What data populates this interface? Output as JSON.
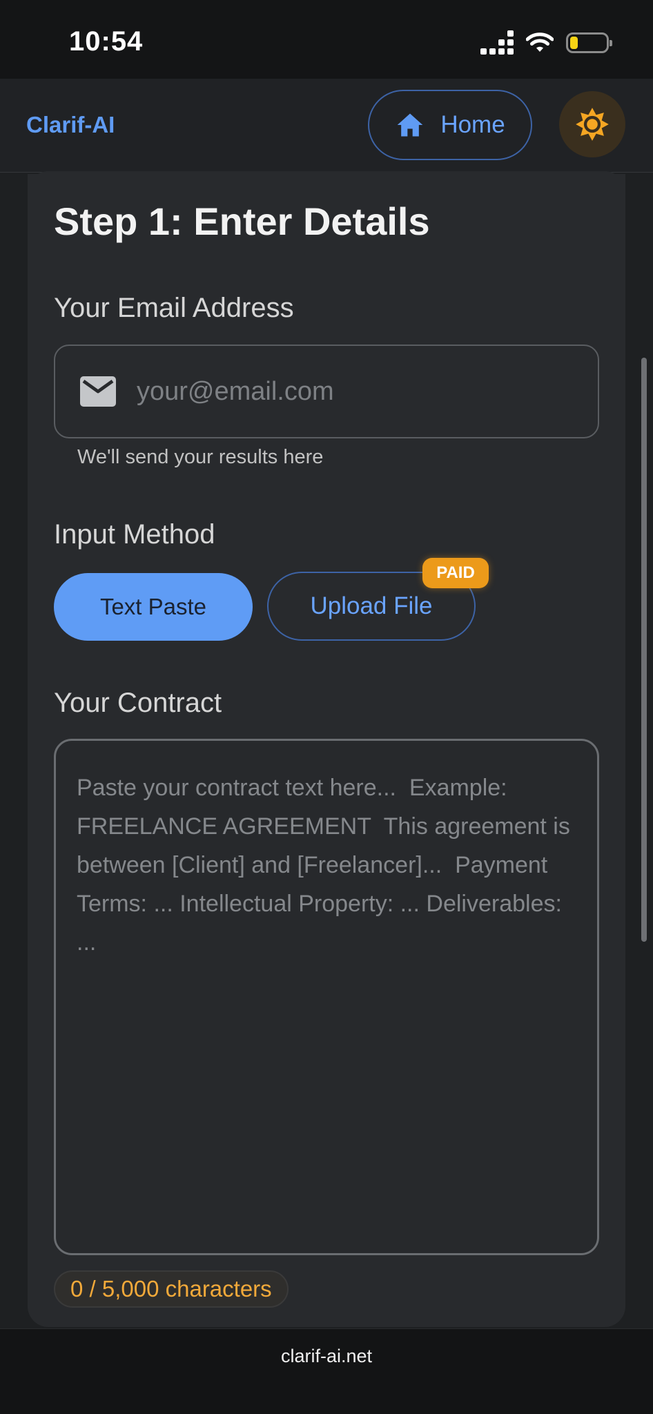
{
  "status_bar": {
    "time": "10:54"
  },
  "header": {
    "brand": "Clarif-AI",
    "home_label": "Home"
  },
  "form": {
    "step_title": "Step 1: Enter Details",
    "email_label": "Your Email Address",
    "email_placeholder": "your@email.com",
    "email_value": "",
    "email_helper": "We'll send your results here",
    "input_method_label": "Input Method",
    "text_paste_label": "Text Paste",
    "upload_file_label": "Upload File",
    "paid_badge": "PAID",
    "contract_label": "Your Contract",
    "contract_placeholder": "Paste your contract text here...  Example:  FREELANCE AGREEMENT  This agreement is between [Client] and [Freelancer]...  Payment Terms: ... Intellectual Property: ... Deliverables: ...",
    "char_count": "0 / 5,000 characters"
  },
  "footer": {
    "url": "clarif-ai.net"
  },
  "colors": {
    "accent": "#5f9cf5",
    "paid": "#ec9a1a",
    "count": "#f2a93a",
    "sun": "#f5a623"
  }
}
